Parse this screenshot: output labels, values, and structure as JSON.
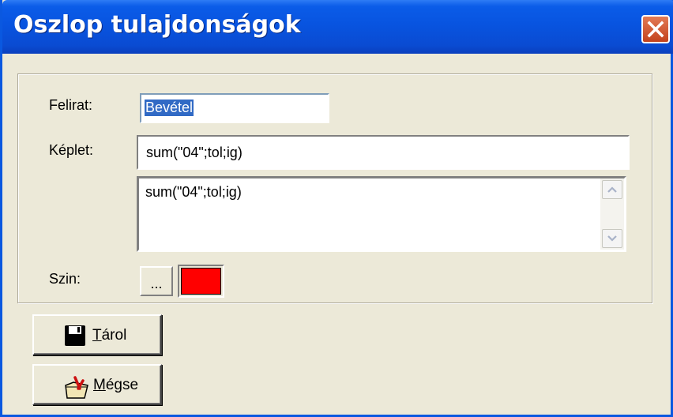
{
  "window": {
    "title": "Oszlop tulajdonságok"
  },
  "form": {
    "caption_label": "Felirat:",
    "caption_value": "Bevétel",
    "formula_label": "Képlet:",
    "formula_value": "sum(\"04\";tol;ig)",
    "formula_memo_value": "sum(\"04\";tol;ig)",
    "color_label": "Szin:",
    "color_pick_label": "...",
    "color_value": "#ff0000"
  },
  "buttons": {
    "save_accel": "T",
    "save_rest": "árol",
    "cancel_accel": "M",
    "cancel_rest": "égse"
  }
}
